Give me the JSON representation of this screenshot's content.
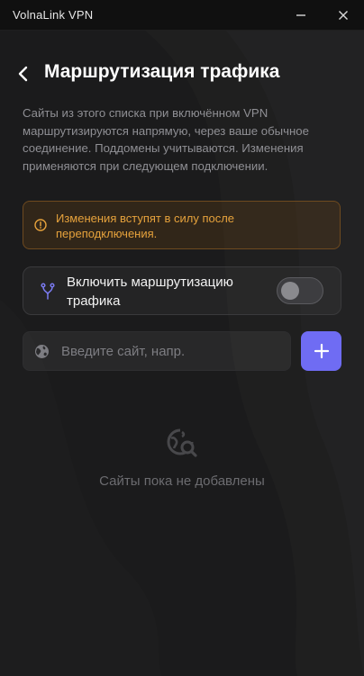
{
  "window": {
    "app_title": "VolnaLink VPN"
  },
  "header": {
    "title": "Маршрутизация трафика"
  },
  "description": "Сайты из этого списка при включённом VPN маршрутизируются напрямую, через ваше обычное соединение. Поддомены учитываются. Изменения применяются при следующем подключении.",
  "warning": {
    "text": "Изменения вступят в силу после переподключения.",
    "color": "#e6a23c"
  },
  "routing_toggle": {
    "label": "Включить маршрутизацию трафика",
    "enabled": false,
    "icon": "route-fork-icon",
    "icon_color": "#7b7bf2"
  },
  "site_input": {
    "value": "",
    "placeholder": "Введите сайт, напр.",
    "icon": "globe-icon"
  },
  "add_button": {
    "icon": "plus-icon",
    "color": "#6f6cf3"
  },
  "empty_state": {
    "icon": "search-globe-icon",
    "text": "Сайты пока не добавлены"
  }
}
